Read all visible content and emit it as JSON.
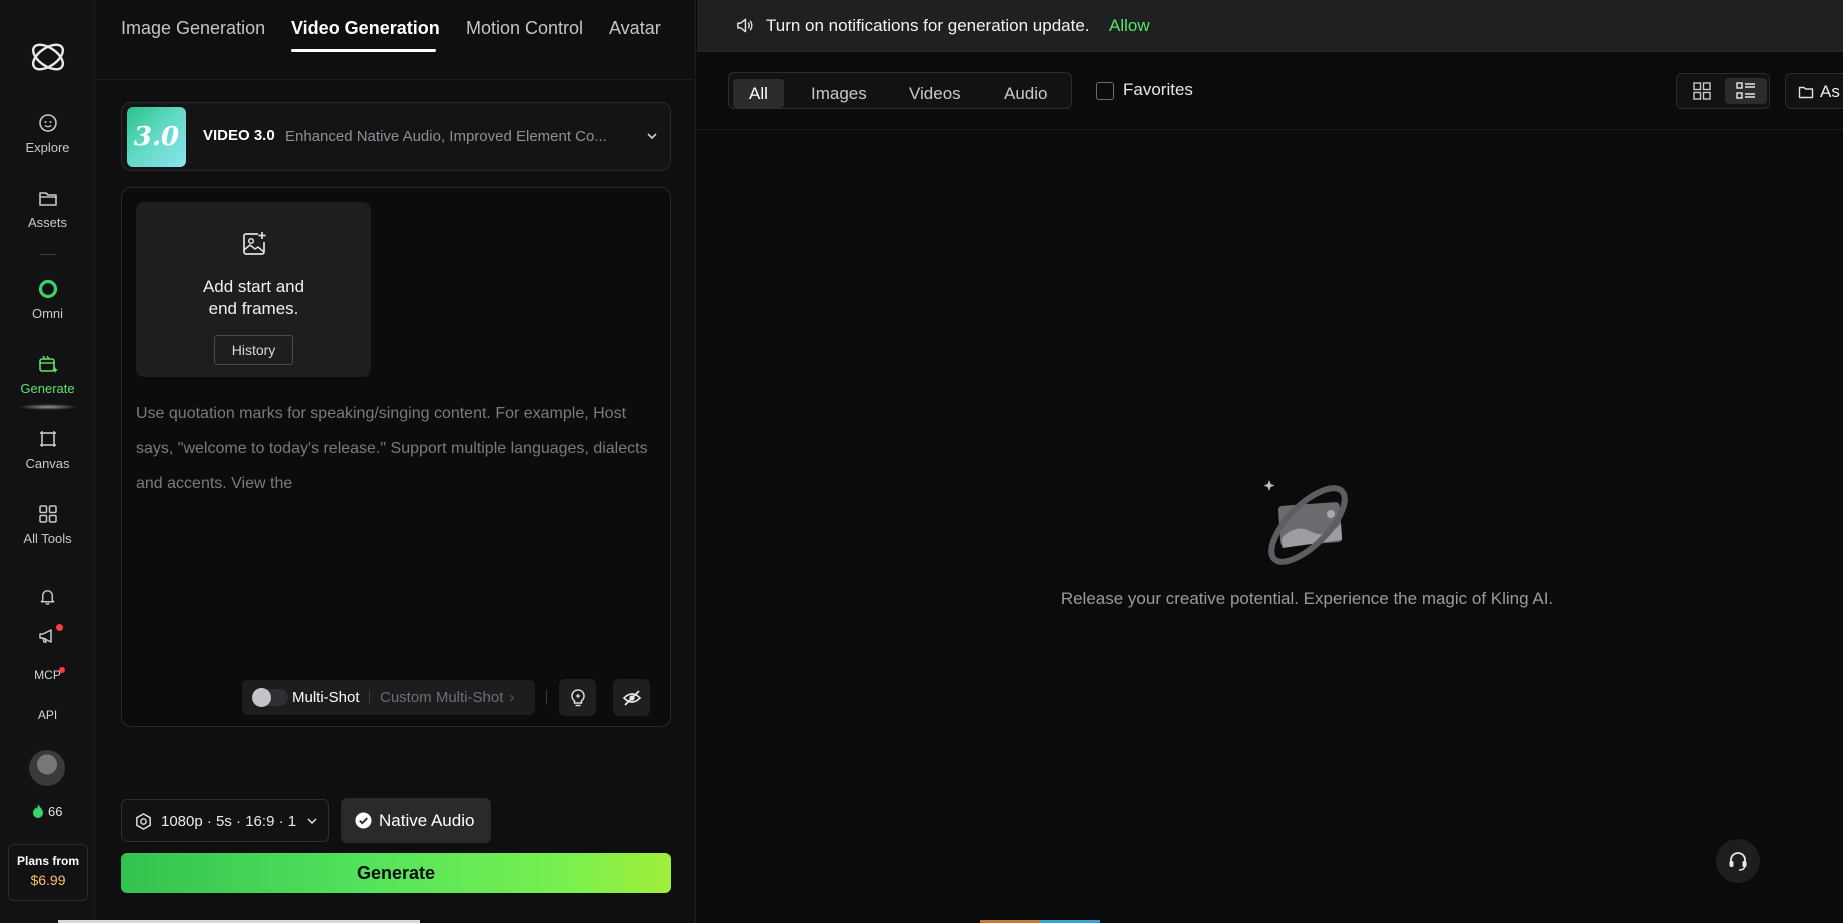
{
  "rail": {
    "items": [
      {
        "label": "Explore",
        "icon": "explore-icon"
      },
      {
        "label": "Assets",
        "icon": "folder-icon"
      },
      {
        "label": "Omni",
        "icon": "omni-icon"
      },
      {
        "label": "Generate",
        "icon": "generate-icon"
      },
      {
        "label": "Canvas",
        "icon": "canvas-icon"
      },
      {
        "label": "All Tools",
        "icon": "grid-icon"
      }
    ],
    "mcp_label": "MCP",
    "api_label": "API",
    "credits": "66",
    "plans_title": "Plans from",
    "plans_price": "$6.99"
  },
  "tabs": [
    {
      "label": "Image Generation"
    },
    {
      "label": "Video Generation"
    },
    {
      "label": "Motion Control"
    },
    {
      "label": "Avatar"
    }
  ],
  "model": {
    "badge": "3.0",
    "name": "VIDEO 3.0",
    "description": "Enhanced Native Audio, Improved Element Co..."
  },
  "frames": {
    "line1": "Add start and",
    "line2": "end frames.",
    "history_label": "History"
  },
  "prompt_placeholder": "Use quotation marks for speaking/singing content. For example, Host says, \"welcome to today's release.\" Support multiple languages, dialects and accents. View the",
  "multishot": {
    "label": "Multi-Shot",
    "custom_label": "Custom Multi-Shot",
    "enabled": false
  },
  "settings_summary": "1080p · 5s · 16:9 · 1",
  "native_audio_label": "Native Audio",
  "generate_label": "Generate",
  "notification": {
    "text": "Turn on notifications for generation update.",
    "action": "Allow"
  },
  "filters": {
    "items": [
      "All",
      "Images",
      "Videos",
      "Audio"
    ],
    "active": "All",
    "favorites_label": "Favorites"
  },
  "assets_button_label": "As",
  "empty_message": "Release your creative potential. Experience the magic of Kling AI.",
  "colors": {
    "accent": "#5ee36a",
    "price": "#f5c067",
    "badge_red": "#ff3b3b"
  }
}
